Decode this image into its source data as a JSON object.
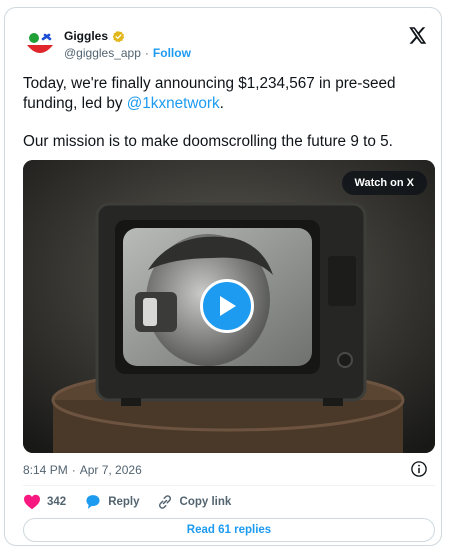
{
  "author": {
    "display_name": "Giggles",
    "handle": "@giggles_app",
    "separator": "·",
    "follow_label": "Follow"
  },
  "tweet": {
    "text_before_mention": "Today, we're finally announcing $1,234,567 in pre-seed funding, led by ",
    "mention": "@1kxnetwork",
    "text_after_mention": ".",
    "paragraph_2": "Our mission is to make doomscrolling the future 9 to 5."
  },
  "media": {
    "watch_label": "Watch on X"
  },
  "meta": {
    "time": "8:14 PM",
    "separator": "·",
    "date": "Apr 7, 2026"
  },
  "actions": {
    "like_count": "342",
    "reply_label": "Reply",
    "copy_link_label": "Copy link"
  },
  "read_replies_label": "Read 61 replies",
  "colors": {
    "accent": "#1d9bf0",
    "like": "#f91880",
    "text": "#0f1419",
    "muted": "#536471",
    "border": "#cfd9de",
    "verified": "#e2b719"
  },
  "icons": [
    "giggles-logo",
    "verified-icon",
    "x-logo-icon",
    "play-icon",
    "info-icon",
    "heart-icon",
    "reply-icon",
    "link-icon"
  ]
}
